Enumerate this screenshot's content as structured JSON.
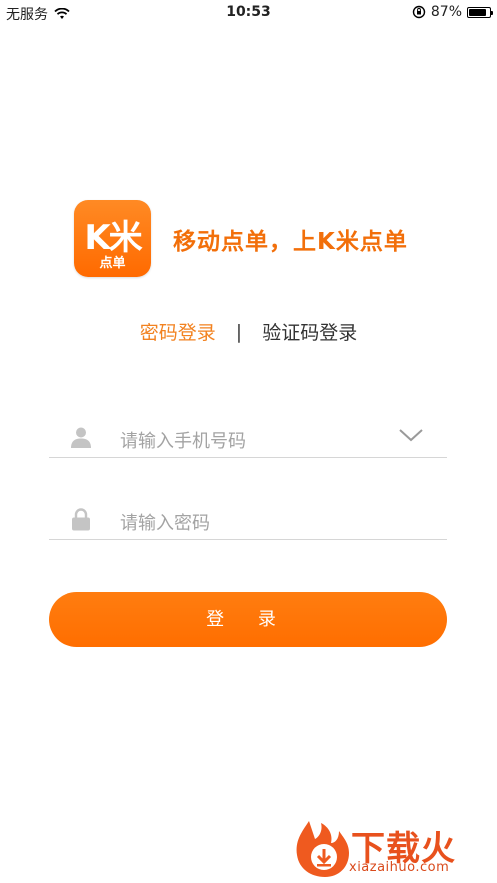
{
  "status_bar": {
    "carrier": "无服务",
    "time": "10:53",
    "battery_percent": "87%",
    "battery_level": 0.87
  },
  "brand": {
    "logo_main": "K米",
    "logo_sub": "点单",
    "slogan": "移动点单，上K米点单"
  },
  "tabs": {
    "password_login": "密码登录",
    "separator": "|",
    "code_login": "验证码登录"
  },
  "form": {
    "phone_placeholder": "请输入手机号码",
    "password_placeholder": "请输入密码",
    "login_button": "登 录"
  },
  "watermark": {
    "title": "下载火",
    "url": "xiazaihuo.com"
  },
  "colors": {
    "accent": "#ff7000",
    "accent_text": "#f28220",
    "placeholder": "#a3a3a3"
  },
  "icons": [
    "wifi-icon",
    "rotation-lock-icon",
    "battery-icon",
    "user-icon",
    "lock-icon",
    "chevron-down-icon"
  ]
}
